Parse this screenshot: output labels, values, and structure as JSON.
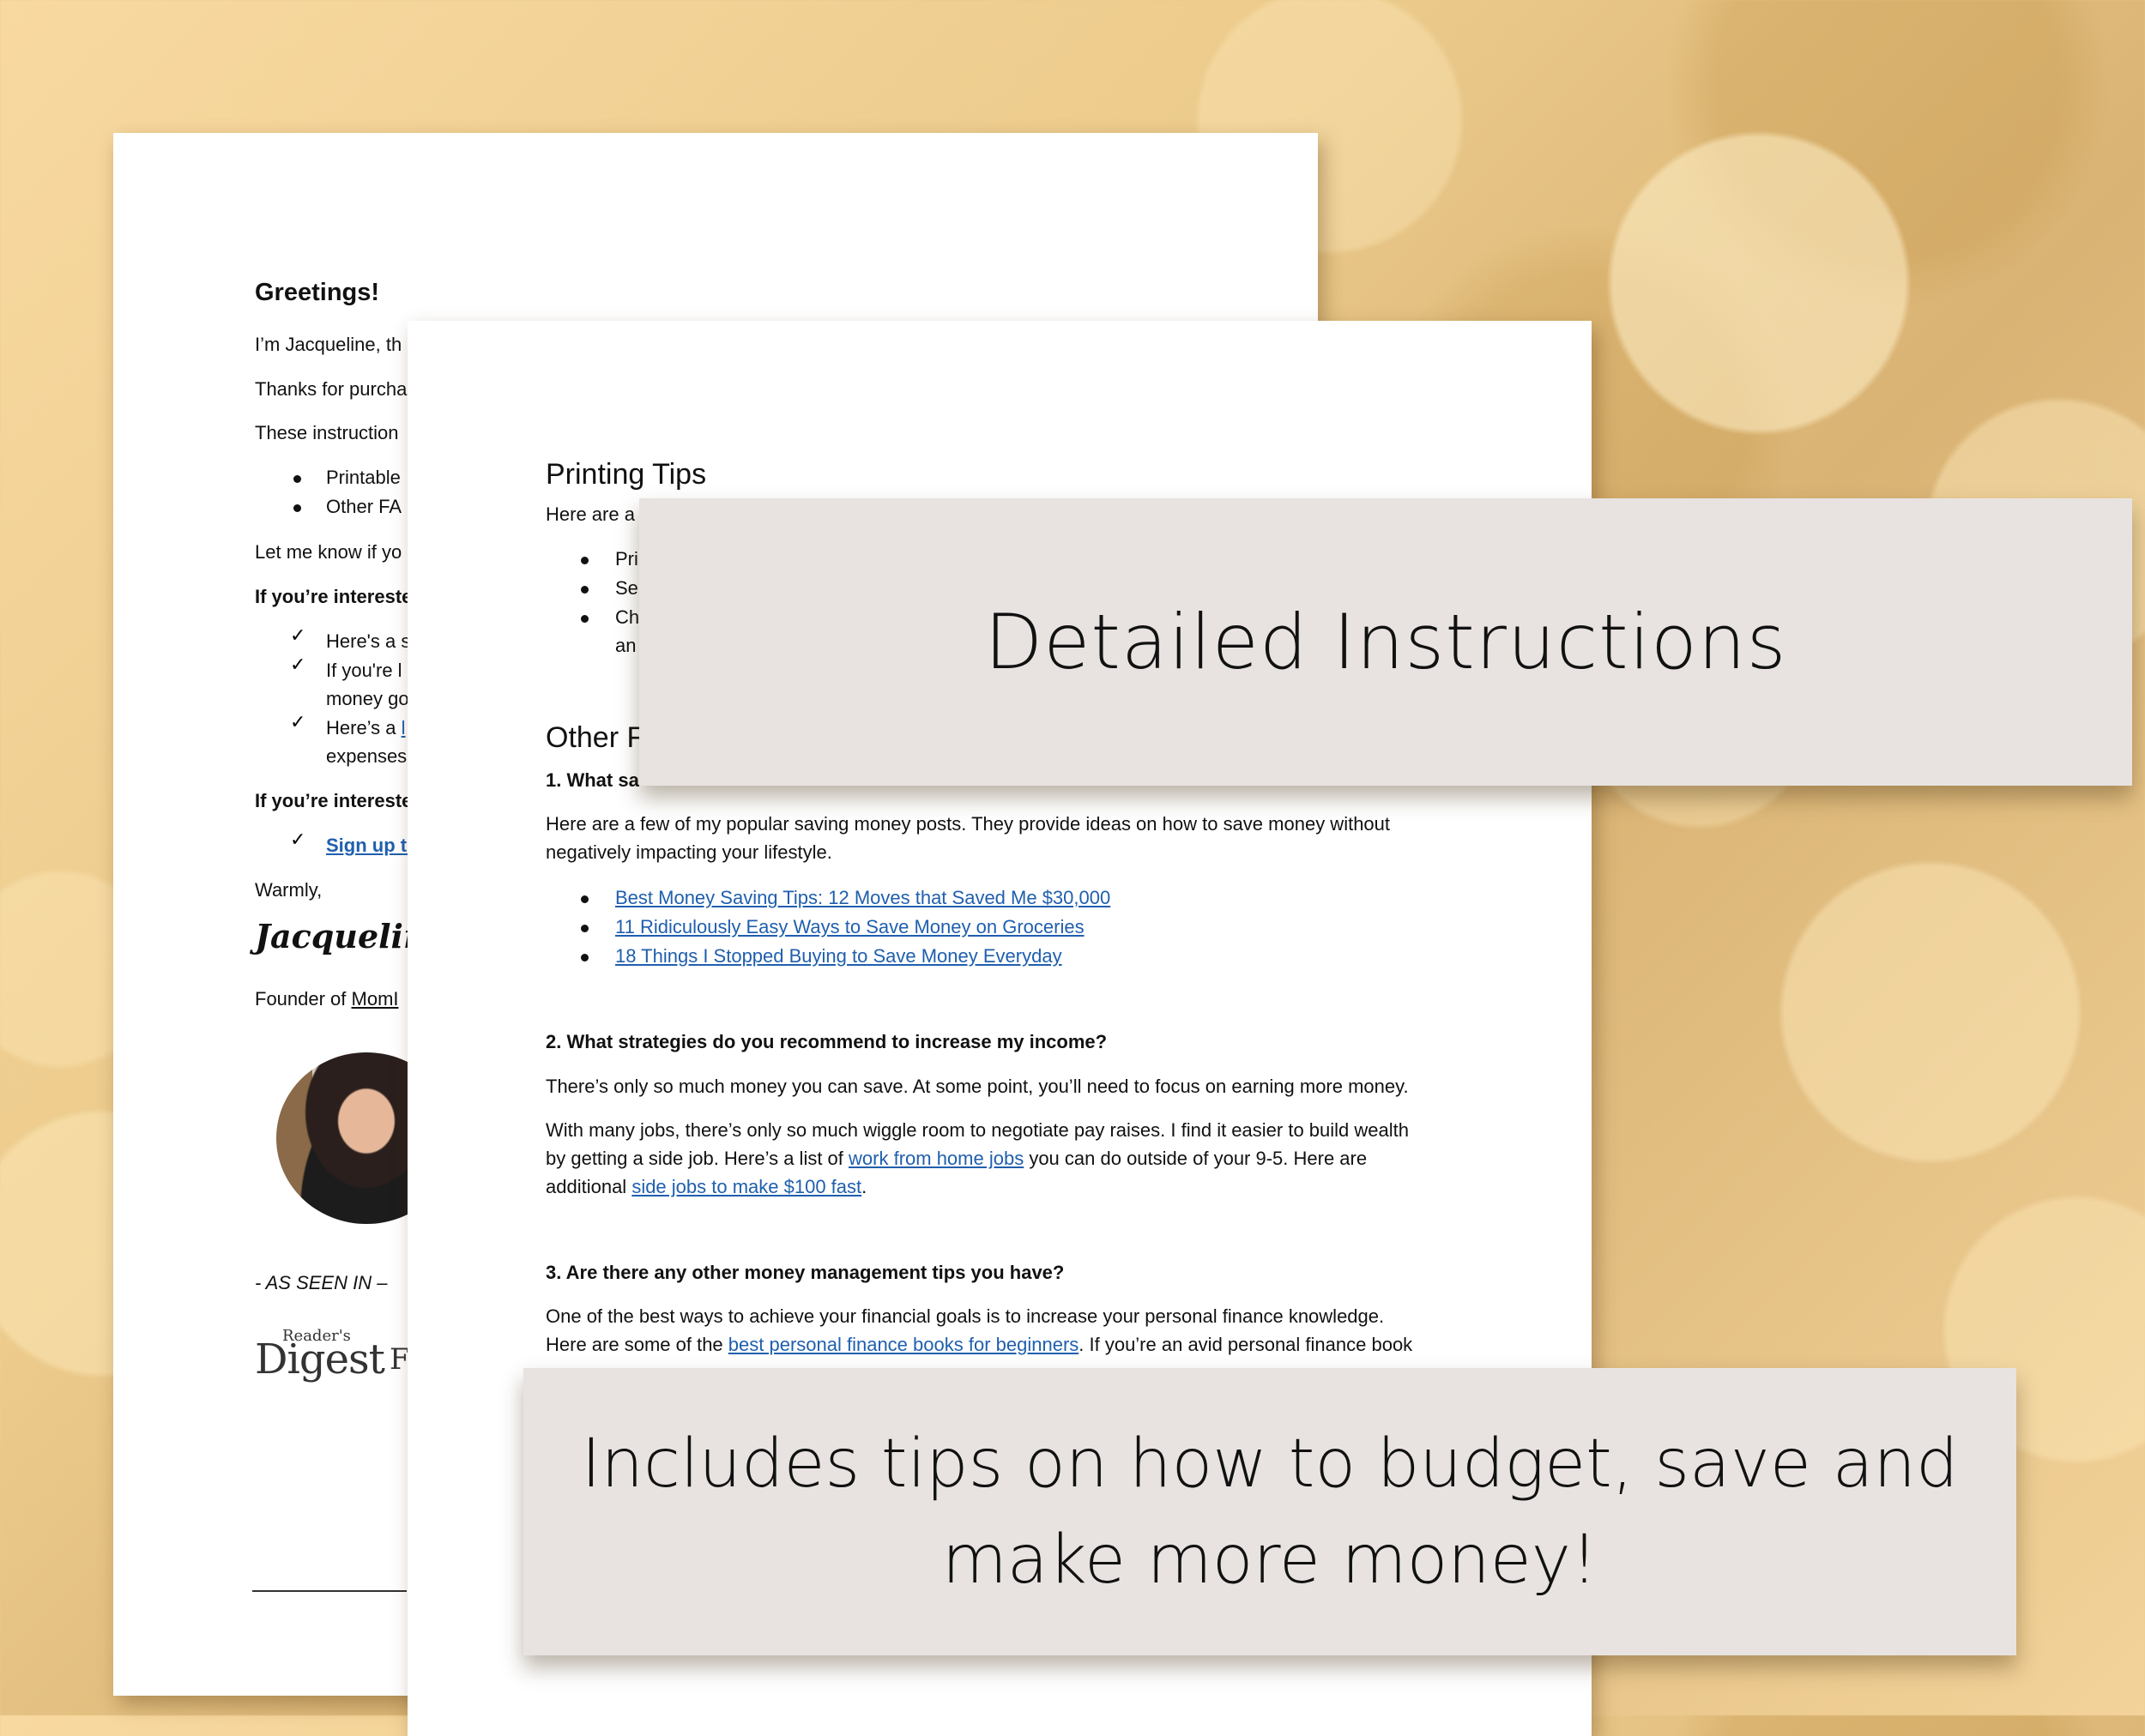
{
  "back_page": {
    "greeting": "Greetings!",
    "lines": [
      "I’m Jacqueline, th",
      "Thanks for purcha",
      "These instruction"
    ],
    "bullets": [
      "Printable",
      "Other FA"
    ],
    "let_me_know": "Let me know if yo",
    "interest1": "If you’re intereste",
    "checks": [
      "Here's a s",
      "If you're l",
      "money go",
      "Here’s a",
      "expenses"
    ],
    "check_link_fragment": "l",
    "interest2": "If you’re intereste",
    "signup": "Sign up to",
    "warmly": "Warmly,",
    "signature": "Jacqueline",
    "founder": "Founder of ",
    "founder_link": "MomI",
    "as_seen_in": "- AS SEEN IN –",
    "logo_readers": "Reader's",
    "logo_digest": "Digest",
    "logo_partial": "F"
  },
  "front_page": {
    "printing_heading": "Printing Tips",
    "printing_intro": "Here are a",
    "printing_bullets": [
      "Pri",
      "Sel",
      "Ch"
    ],
    "printing_bullet_cont": "an",
    "other_heading": "Other F",
    "q1": "1. What sa",
    "q1_para": [
      "Here are a few of my popular saving money posts. They provide ideas on how to save money without",
      "negatively impacting your lifestyle."
    ],
    "q1_links": [
      "Best Money Saving Tips: 12 Moves that Saved Me $30,000",
      "11 Ridiculously Easy Ways to Save Money on Groceries",
      "18 Things I Stopped Buying to Save Money Everyday"
    ],
    "q2": "2. What strategies do you recommend to increase my income?",
    "q2_para1": "There’s only so much money you can save. At some point, you’ll need to focus on earning more money.",
    "q2_para2_l1": "With many jobs, there’s only so much wiggle room to negotiate pay raises. I find it easier to build wealth",
    "q2_para2_l2a": "by getting a side job. Here’s a list of ",
    "q2_para2_link1": "work from home jobs",
    "q2_para2_l2b": " you can do outside of your 9-5. Here are",
    "q2_para2_l3a": "additional ",
    "q2_para2_link2": "side jobs to make $100 fast",
    "q2_para2_l3b": ".",
    "q3": "3. Are there any other money management tips you have?",
    "q3_l1": "One of the best ways to achieve your financial goals is to increase your personal finance knowledge.",
    "q3_l2a": "Here are some of the ",
    "q3_link": "best personal finance books for beginners",
    "q3_l2b": ". If you’re an avid personal finance book"
  },
  "banners": {
    "top": "Detailed Instructions",
    "bottom_line1": "Includes tips on how to budget, save and",
    "bottom_line2": "make more money!"
  },
  "colors": {
    "link": "#1f5fae",
    "banner_bg": "#e8e3e1",
    "background": "#eccb8c"
  }
}
